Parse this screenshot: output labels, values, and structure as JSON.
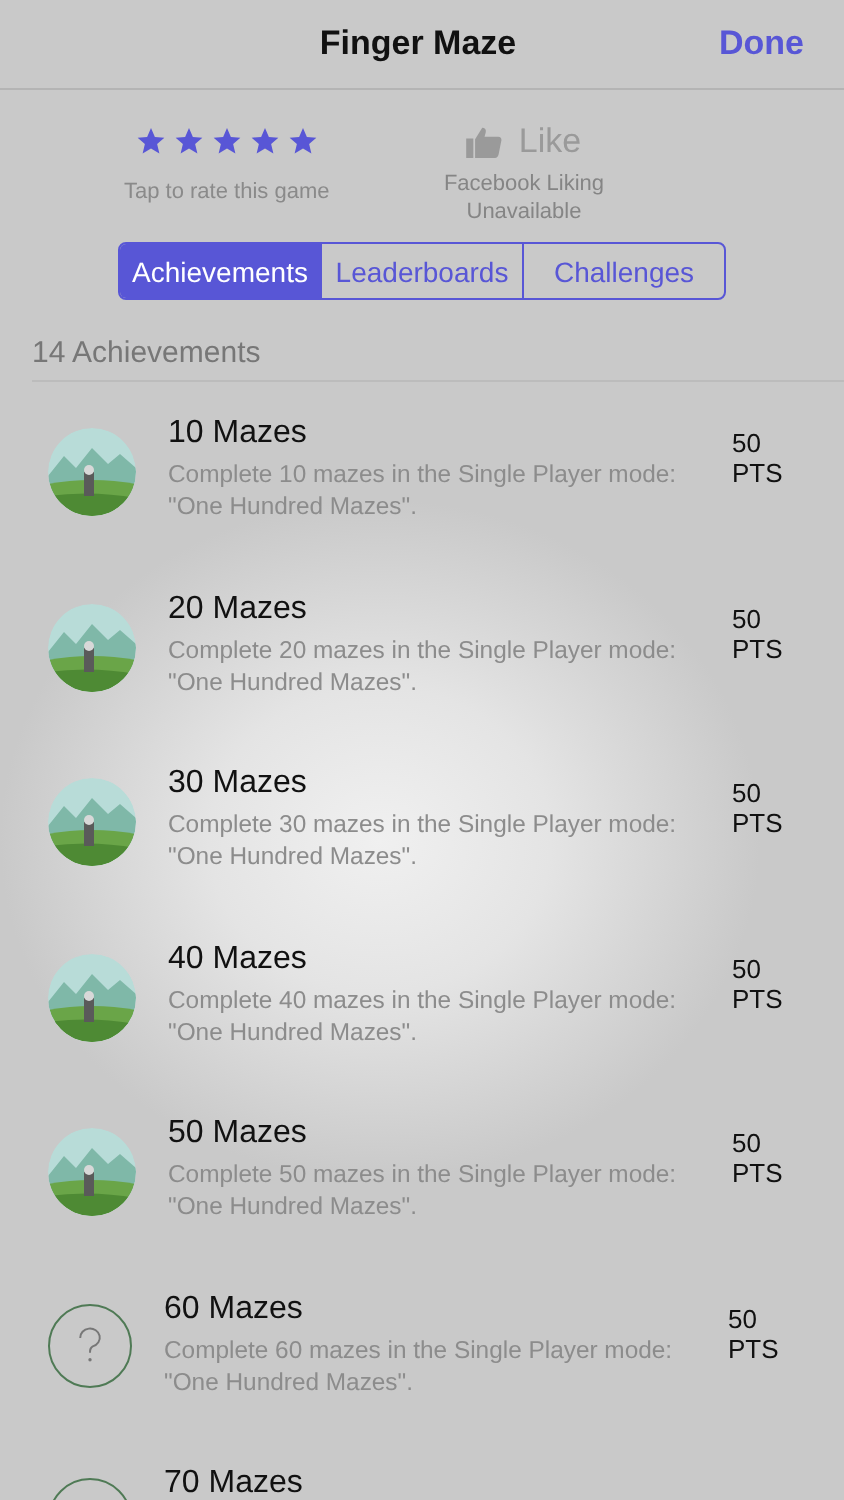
{
  "nav_bar": {
    "title": "Finger Maze",
    "done": "Done"
  },
  "rating": {
    "stars": 5,
    "caption": "Tap to rate this game"
  },
  "like": {
    "label": "Like",
    "caption": "Facebook Liking Unavailable",
    "disabled": true
  },
  "tabs": [
    {
      "label": "Achievements",
      "selected": true
    },
    {
      "label": "Leaderboards",
      "selected": false
    },
    {
      "label": "Challenges",
      "selected": false
    }
  ],
  "section_header": "14 Achievements",
  "achievements": [
    {
      "kind": "unlocked",
      "title": "10 Mazes",
      "description": "Complete 10 mazes in the Single Player mode: \"One Hundred Mazes\".",
      "points": "50",
      "unit": "PTS"
    },
    {
      "kind": "unlocked",
      "title": "20 Mazes",
      "description": "Complete 20 mazes in the Single Player mode: \"One Hundred Mazes\".",
      "points": "50",
      "unit": "PTS"
    },
    {
      "kind": "unlocked",
      "title": "30 Mazes",
      "description": "Complete 30 mazes in the Single Player mode: \"One Hundred Mazes\".",
      "points": "50",
      "unit": "PTS"
    },
    {
      "kind": "unlocked",
      "title": "40 Mazes",
      "description": "Complete 40 mazes in the Single Player mode: \"One Hundred Mazes\".",
      "points": "50",
      "unit": "PTS"
    },
    {
      "kind": "unlocked",
      "title": "50 Mazes",
      "description": "Complete 50 mazes in the Single Player mode: \"One Hundred Mazes\".",
      "points": "50",
      "unit": "PTS"
    },
    {
      "kind": "locked",
      "title": "60 Mazes",
      "description": "Complete 60 mazes in the Single Player mode: \"One Hundred Mazes\".",
      "points": "50",
      "unit": "PTS"
    },
    {
      "kind": "locked",
      "title": "70 Mazes"
    }
  ]
}
